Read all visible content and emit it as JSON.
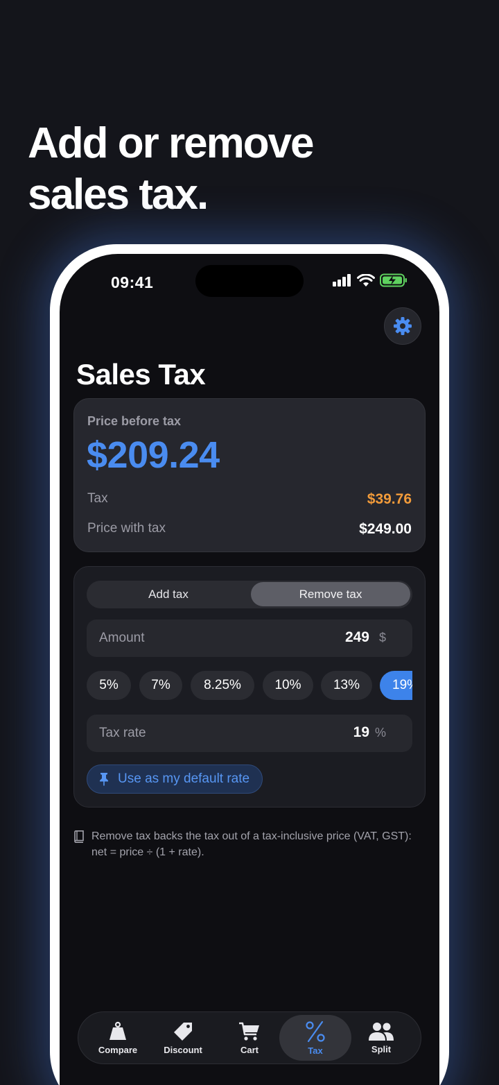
{
  "headline": {
    "line1": "Add or remove",
    "line2": "sales tax."
  },
  "status": {
    "time": "09:41"
  },
  "page": {
    "title": "Sales Tax"
  },
  "result": {
    "label": "Price before tax",
    "value": "$209.24",
    "tax_label": "Tax",
    "tax_value": "$39.76",
    "with_tax_label": "Price with tax",
    "with_tax_value": "$249.00"
  },
  "mode": {
    "add_label": "Add tax",
    "remove_label": "Remove tax",
    "selected": "Remove tax"
  },
  "amount": {
    "label": "Amount",
    "value": "249",
    "unit": "$"
  },
  "rate_chips": [
    "5%",
    "7%",
    "8.25%",
    "10%",
    "13%",
    "19%"
  ],
  "selected_rate_chip": "19%",
  "tax_rate": {
    "label": "Tax rate",
    "value": "19",
    "unit": "%"
  },
  "default_rate_button": "Use as my default rate",
  "footnote": "Remove tax backs the tax out of a tax-inclusive price (VAT, GST): net = price ÷ (1 + rate).",
  "tabs": [
    {
      "label": "Compare",
      "icon": "weight-icon"
    },
    {
      "label": "Discount",
      "icon": "tag-icon"
    },
    {
      "label": "Cart",
      "icon": "cart-icon"
    },
    {
      "label": "Tax",
      "icon": "percent-icon"
    },
    {
      "label": "Split",
      "icon": "people-icon"
    }
  ],
  "active_tab": "Tax",
  "colors": {
    "accent": "#4a8cf0",
    "tax_amount": "#f29b3a",
    "background": "#14151b"
  }
}
